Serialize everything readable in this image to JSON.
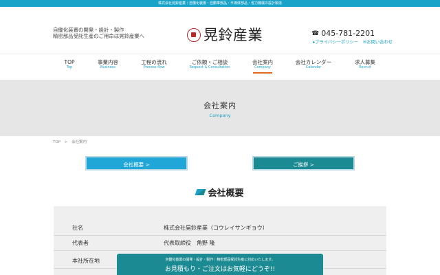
{
  "topbar": {
    "text": "株式会社晃鈴産業｜自働化装置・自動車部品・半導体部品・省力機械の設計製造"
  },
  "header": {
    "tagline_line1": "自働化装置の開発・設計・製作",
    "tagline_line2": "精密部品受託生産のご用命は晃鈴産業へ",
    "logo_text": "晃鈴産業",
    "phone": "045-781-2201",
    "links": [
      {
        "label": "プライバシーポリシー"
      },
      {
        "label": "お問い合わせ"
      }
    ]
  },
  "nav": {
    "items": [
      {
        "label": "TOP",
        "sub": "Top"
      },
      {
        "label": "事業内容",
        "sub": "Business"
      },
      {
        "label": "工程の流れ",
        "sub": "Process flow"
      },
      {
        "label": "ご依頼・ご相談",
        "sub": "Request & Consultation"
      },
      {
        "label": "会社案内",
        "sub": "Company"
      },
      {
        "label": "会社カレンダー",
        "sub": "Calendar"
      },
      {
        "label": "求人募集",
        "sub": "Recruit"
      }
    ]
  },
  "hero": {
    "title": "会社案内",
    "subtitle": "Company"
  },
  "breadcrumb": {
    "home": "TOP",
    "separator": ">",
    "current": "会社案内"
  },
  "anchors": {
    "overview": "会社概要",
    "greeting": "ご挨拶"
  },
  "section": {
    "title": "会社概要"
  },
  "info": {
    "rows": [
      {
        "label": "社名",
        "value": "株式会社晃鈴産業（コウレイサンギョウ）"
      },
      {
        "label": "代表者",
        "value": "代表取締役　角野 隆"
      },
      {
        "label": "本社所在地",
        "value": ""
      }
    ]
  },
  "cta": {
    "small": "自働化装置の開発・設計・製作｜精密部品受託生産に対応いたします。",
    "main": "お見積もり・ご注文はお気軽にどうぞ!!"
  }
}
